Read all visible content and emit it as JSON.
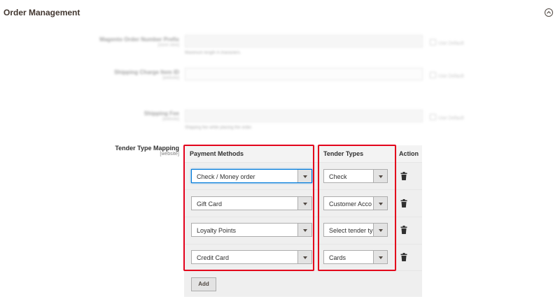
{
  "section": {
    "title": "Order Management"
  },
  "blurred_rows": [
    {
      "label": "Magento Order Number Prefix",
      "scope": "[store view]",
      "value": "",
      "note": "Maximum length 4 characters.",
      "use_default": "Use Default"
    },
    {
      "label": "Shipping Charge Item ID",
      "scope": "[website]",
      "value": "",
      "note": "",
      "use_default": "Use Default"
    },
    {
      "label": "Shipping Fee",
      "scope": "[website]",
      "value": "",
      "note": "Shipping fee while placing the order.",
      "use_default": "Use Default"
    }
  ],
  "tender_mapping": {
    "label": "Tender Type Mapping",
    "scope": "[website]",
    "columns": {
      "payment": "Payment Methods",
      "tender": "Tender Types",
      "action": "Action"
    },
    "rows": [
      {
        "payment": "Check / Money order",
        "tender": "Check"
      },
      {
        "payment": "Gift Card",
        "tender": "Customer Acco"
      },
      {
        "payment": "Loyalty Points",
        "tender": "Select tender ty"
      },
      {
        "payment": "Credit Card",
        "tender": "Cards"
      }
    ],
    "add_label": "Add"
  },
  "icons": {
    "collapse": "chevron-up-icon",
    "delete": "trash-icon",
    "dropdown": "chevron-down-icon"
  },
  "colors": {
    "highlight": "#e3001b",
    "focus": "#007bdb",
    "grid_bg": "#efefef"
  }
}
